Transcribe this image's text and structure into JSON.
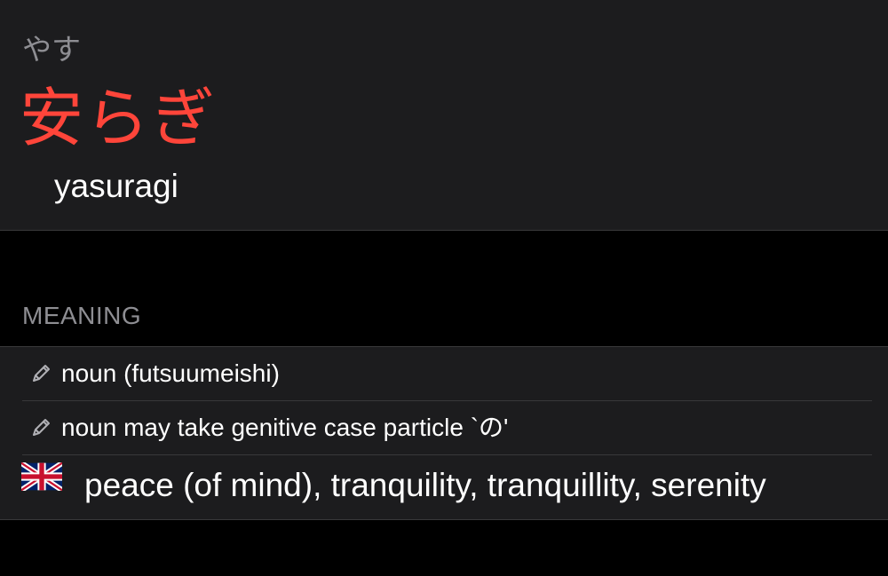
{
  "entry": {
    "reading": "やす",
    "word": "安らぎ",
    "romaji": "yasuragi",
    "word_color": "#ff453a"
  },
  "meaning": {
    "section_title": "MEANING",
    "parts_of_speech": [
      {
        "icon": "pencil-icon",
        "label": "noun (futsuumeishi)"
      },
      {
        "icon": "pencil-icon",
        "label": "noun may take genitive case particle `の'"
      }
    ],
    "gloss": {
      "icon": "uk-flag-icon",
      "text": "peace (of mind), tranquility, tranquillity, serenity"
    }
  }
}
